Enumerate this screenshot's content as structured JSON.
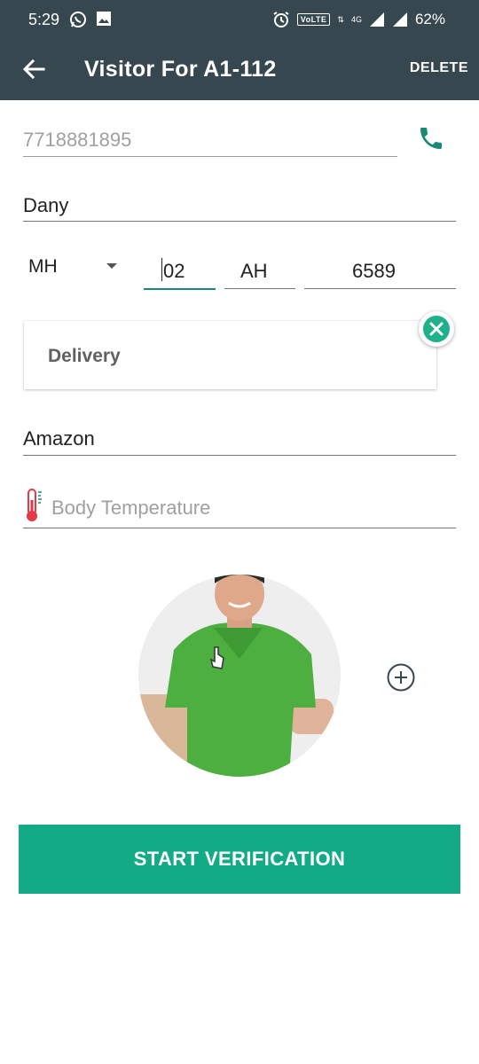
{
  "status_bar": {
    "time": "5:29",
    "left_icons": [
      "whatsapp-icon",
      "gallery-icon"
    ],
    "volte": "VoLTE",
    "network": "4G",
    "battery": "62%"
  },
  "app_bar": {
    "title": "Visitor For  A1-112",
    "delete_label": "DELETE"
  },
  "form": {
    "phone": {
      "value": "7718881895"
    },
    "name": {
      "value": "Dany"
    },
    "vehicle": {
      "state": "MH",
      "district": "02",
      "series": "AH",
      "number": "6589"
    },
    "purpose": {
      "label": "Delivery"
    },
    "company": {
      "value": "Amazon"
    },
    "temperature": {
      "placeholder": "Body Temperature"
    }
  },
  "actions": {
    "start_label": "START VERIFICATION"
  },
  "colors": {
    "app_bar": "#37474f",
    "accent": "#13aa86",
    "focus_underline": "#1a8a76"
  }
}
